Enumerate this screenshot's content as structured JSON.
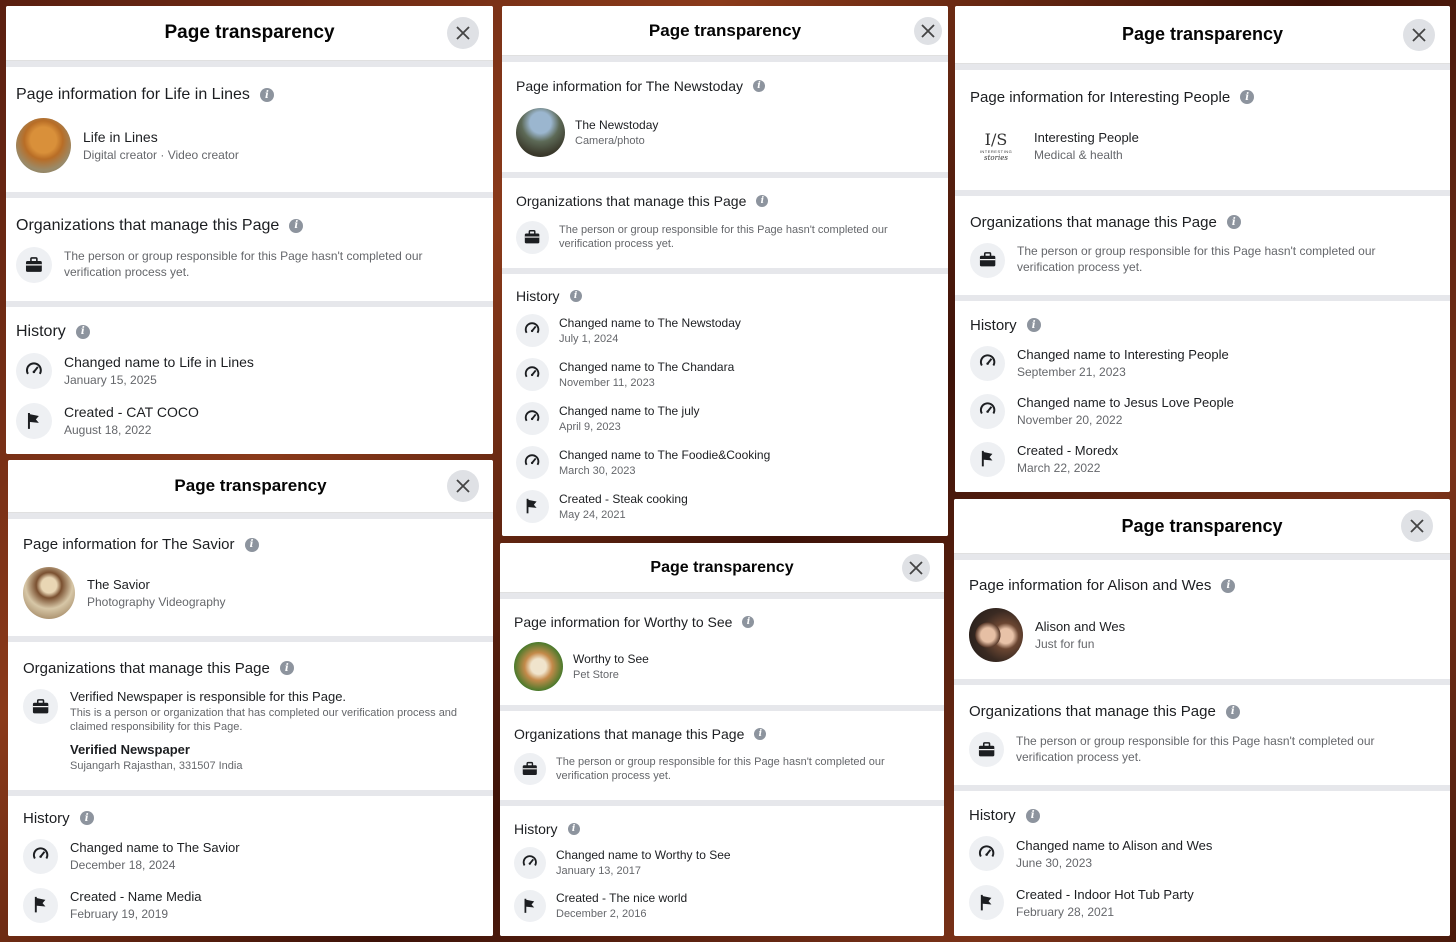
{
  "common": {
    "header_title": "Page transparency",
    "orgs_heading": "Organizations that manage this Page",
    "history_heading": "History",
    "unverified_text": "The person or group responsible for this Page hasn't completed our verification process yet.",
    "info_glyph": "i"
  },
  "icons": {
    "close": "close-x-icon",
    "info": "info-icon",
    "briefcase": "briefcase-icon",
    "rename": "rename-gauge-icon",
    "created": "flag-icon"
  },
  "panels": [
    {
      "info_heading": "Page information for Life in Lines",
      "page_name": "Life in Lines",
      "page_category": "Digital creator · Video creator",
      "avatar": "cat-photo",
      "history": [
        {
          "title": "Changed name to Life in Lines",
          "date": "January 15, 2025",
          "type": "rename"
        },
        {
          "title": "Created - CAT COCO",
          "date": "August 18, 2022",
          "type": "created"
        }
      ]
    },
    {
      "info_heading": "Page information for The Newstoday",
      "page_name": "The Newstoday",
      "page_category": "Camera/photo",
      "avatar": "soldier-photo",
      "history": [
        {
          "title": "Changed name to The Newstoday",
          "date": "July 1, 2024",
          "type": "rename"
        },
        {
          "title": "Changed name to The Chandara",
          "date": "November 11, 2023",
          "type": "rename"
        },
        {
          "title": "Changed name to The july",
          "date": "April 9, 2023",
          "type": "rename"
        },
        {
          "title": "Changed name to The Foodie&Cooking",
          "date": "March 30, 2023",
          "type": "rename"
        },
        {
          "title": "Created - Steak cooking",
          "date": "May 24, 2021",
          "type": "created"
        }
      ]
    },
    {
      "info_heading": "Page information for Interesting People",
      "page_name": "Interesting People",
      "page_category": "Medical & health",
      "avatar": "logo",
      "logo_text": "I/S",
      "logo_sub": "INTERESTING",
      "logo_sub2": "stories",
      "history": [
        {
          "title": "Changed name to Interesting People",
          "date": "September 21, 2023",
          "type": "rename"
        },
        {
          "title": "Changed name to Jesus Love People",
          "date": "November 20, 2022",
          "type": "rename"
        },
        {
          "title": "Created - Moredx",
          "date": "March 22, 2022",
          "type": "created"
        }
      ]
    },
    {
      "info_heading": "Page information for The Savior",
      "page_name": "The Savior",
      "page_category": "Photography Videography",
      "avatar": "jesus-photo",
      "verified": {
        "title": "Verified Newspaper is responsible for this Page.",
        "desc": "This is a person or organization that has completed our verification process and claimed responsibility for this Page.",
        "org_name": "Verified Newspaper",
        "org_location": "Sujangarh Rajasthan, 331507 India"
      },
      "history": [
        {
          "title": "Changed name to The Savior",
          "date": "December 18, 2024",
          "type": "rename"
        },
        {
          "title": "Created - Name Media",
          "date": "February 19, 2019",
          "type": "created"
        }
      ]
    },
    {
      "info_heading": "Page information for Worthy to See",
      "page_name": "Worthy to See",
      "page_category": "Pet Store",
      "avatar": "dog-photo",
      "history": [
        {
          "title": "Changed name to Worthy to See",
          "date": "January 13, 2017",
          "type": "rename"
        },
        {
          "title": "Created - The nice world",
          "date": "December 2, 2016",
          "type": "created"
        }
      ]
    },
    {
      "info_heading": "Page information for Alison and Wes",
      "page_name": "Alison and Wes",
      "page_category": "Just for fun",
      "avatar": "couple-photo",
      "history": [
        {
          "title": "Changed name to Alison and Wes",
          "date": "June 30, 2023",
          "type": "rename"
        },
        {
          "title": "Created - Indoor Hot Tub Party",
          "date": "February 28, 2021",
          "type": "created"
        }
      ]
    }
  ]
}
